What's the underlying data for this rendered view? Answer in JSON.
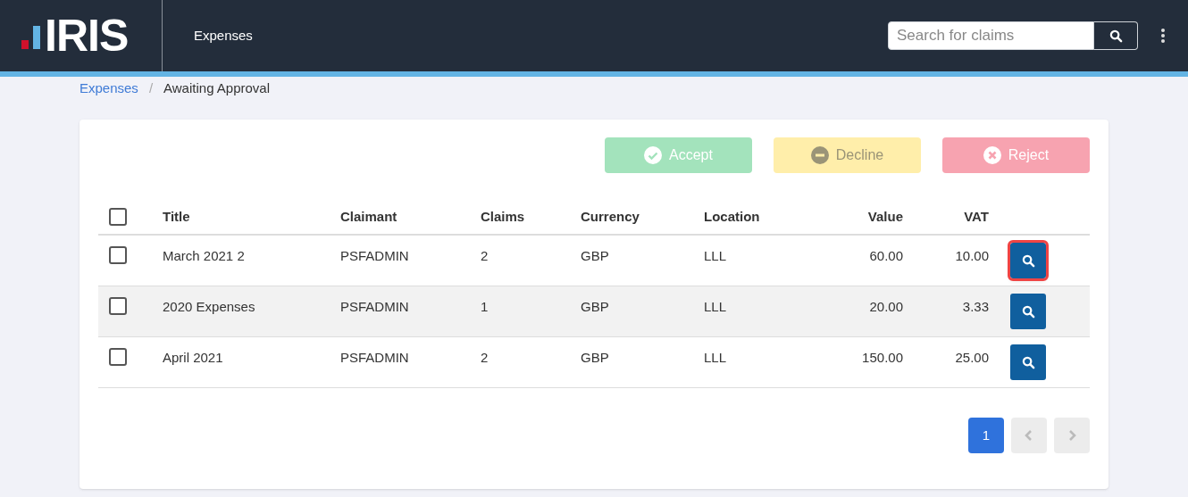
{
  "header": {
    "logo": "IRIS",
    "app_title": "Expenses",
    "search": {
      "placeholder": "Search for claims"
    }
  },
  "breadcrumb": [
    {
      "label": "Expenses",
      "kind": "link"
    },
    {
      "label": "/",
      "kind": "separator"
    },
    {
      "label": "Awaiting Approval",
      "kind": "current"
    }
  ],
  "actions": [
    {
      "label": "Accept",
      "kind": "accept",
      "disabled": true
    },
    {
      "label": "Decline",
      "kind": "decline",
      "disabled": true
    },
    {
      "label": "Reject",
      "kind": "reject",
      "disabled": true
    }
  ],
  "table": {
    "select_all": {
      "checked": false
    },
    "columns": [
      "Title",
      "Claimant",
      "Claims",
      "Currency",
      "Location",
      "Value",
      "VAT"
    ],
    "rows": [
      {
        "cells": [
          "March 2021 2",
          "PSFADMIN",
          "2",
          "GBP",
          "LLL",
          "60.00",
          "10.00"
        ],
        "checked": false,
        "shaded": false,
        "highlighted": true
      },
      {
        "cells": [
          "2020 Expenses",
          "PSFADMIN",
          "1",
          "GBP",
          "LLL",
          "20.00",
          "3.33"
        ],
        "checked": false,
        "shaded": true,
        "highlighted": false
      },
      {
        "cells": [
          "April 2021",
          "PSFADMIN",
          "2",
          "GBP",
          "LLL",
          "150.00",
          "25.00"
        ],
        "checked": false,
        "shaded": false,
        "highlighted": false
      }
    ]
  },
  "pagination": [
    {
      "label": "1",
      "selected": true
    }
  ]
}
